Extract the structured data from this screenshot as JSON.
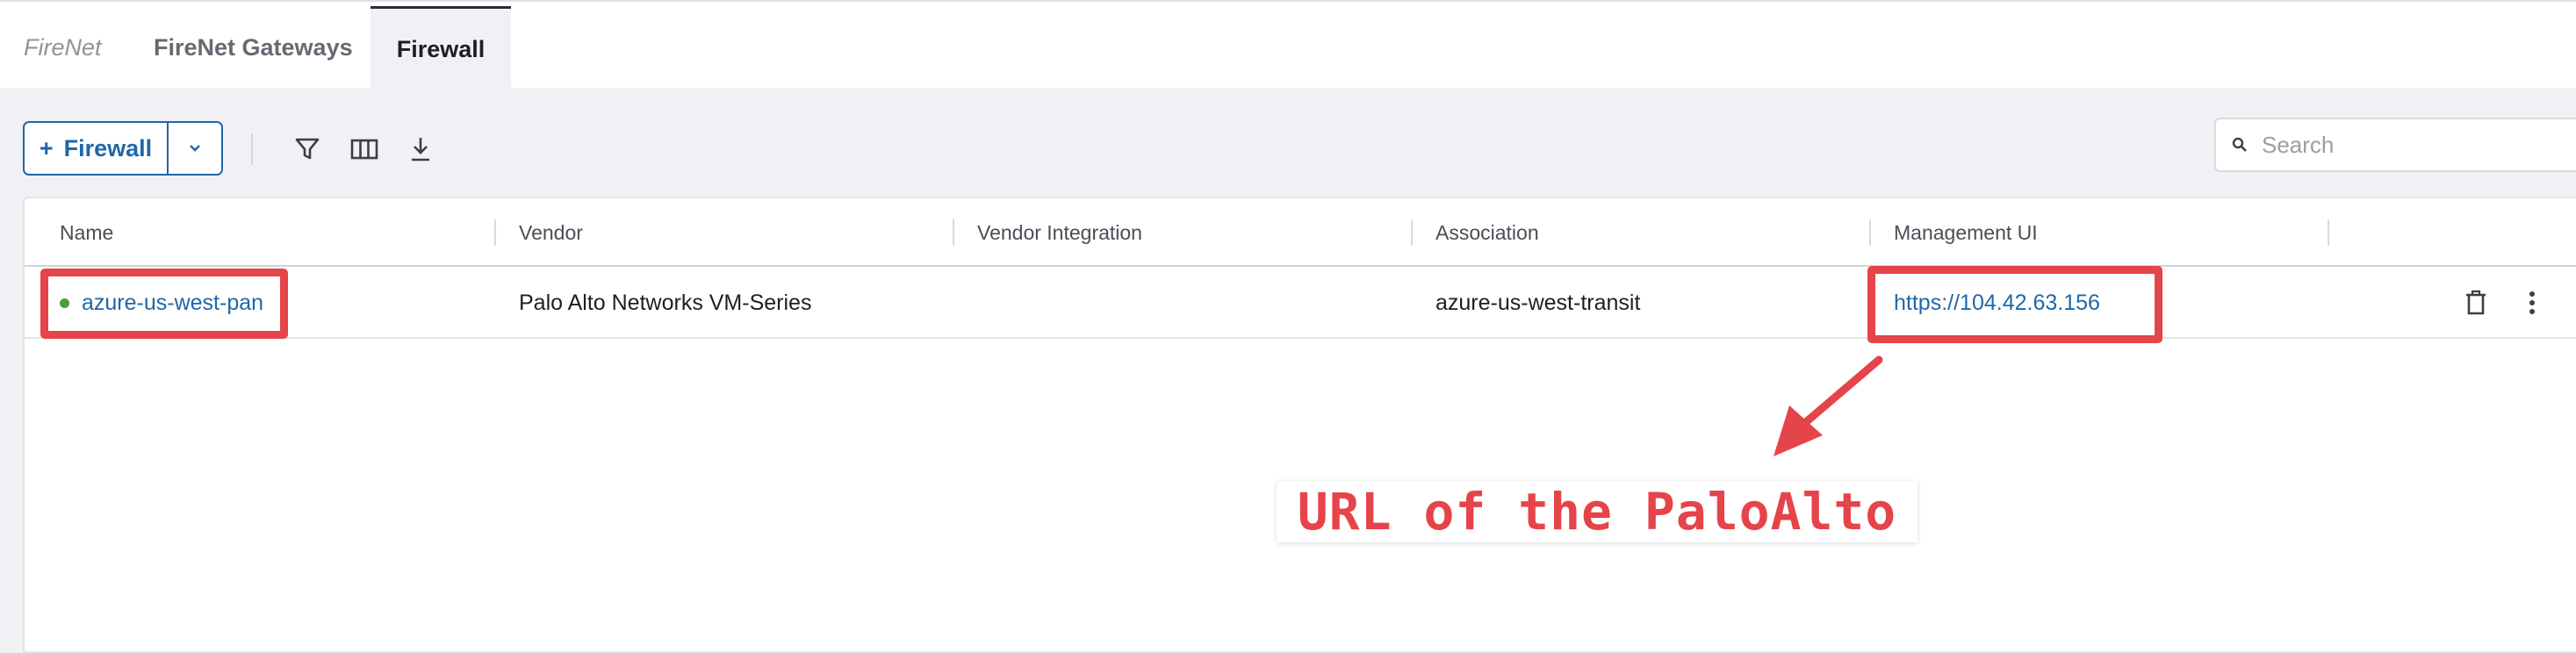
{
  "tabs": {
    "crumb": "FireNet",
    "gateways": "FireNet Gateways",
    "active": "Firewall"
  },
  "toolbar": {
    "add_plus": "+",
    "add_label": "Firewall",
    "icons": [
      "chevron-down-icon",
      "filter-icon",
      "columns-icon",
      "download-icon"
    ]
  },
  "search": {
    "placeholder": "Search"
  },
  "table": {
    "headers": {
      "name": "Name",
      "vendor": "Vendor",
      "integration": "Vendor Integration",
      "association": "Association",
      "management": "Management UI"
    },
    "rows": [
      {
        "name": "azure-us-west-pan",
        "status": "up",
        "vendor": "Palo Alto Networks VM-Series",
        "integration": "",
        "association": "azure-us-west-transit",
        "management": "https://104.42.63.156"
      }
    ],
    "row_icons": [
      "trash-icon",
      "more-vertical-icon"
    ]
  },
  "annotation": {
    "label": "URL of the PaloAlto",
    "color": "#e5444a"
  },
  "colors": {
    "accent": "#1f67a8",
    "status_up": "#4c9b3d",
    "annotation": "#e5444a"
  }
}
